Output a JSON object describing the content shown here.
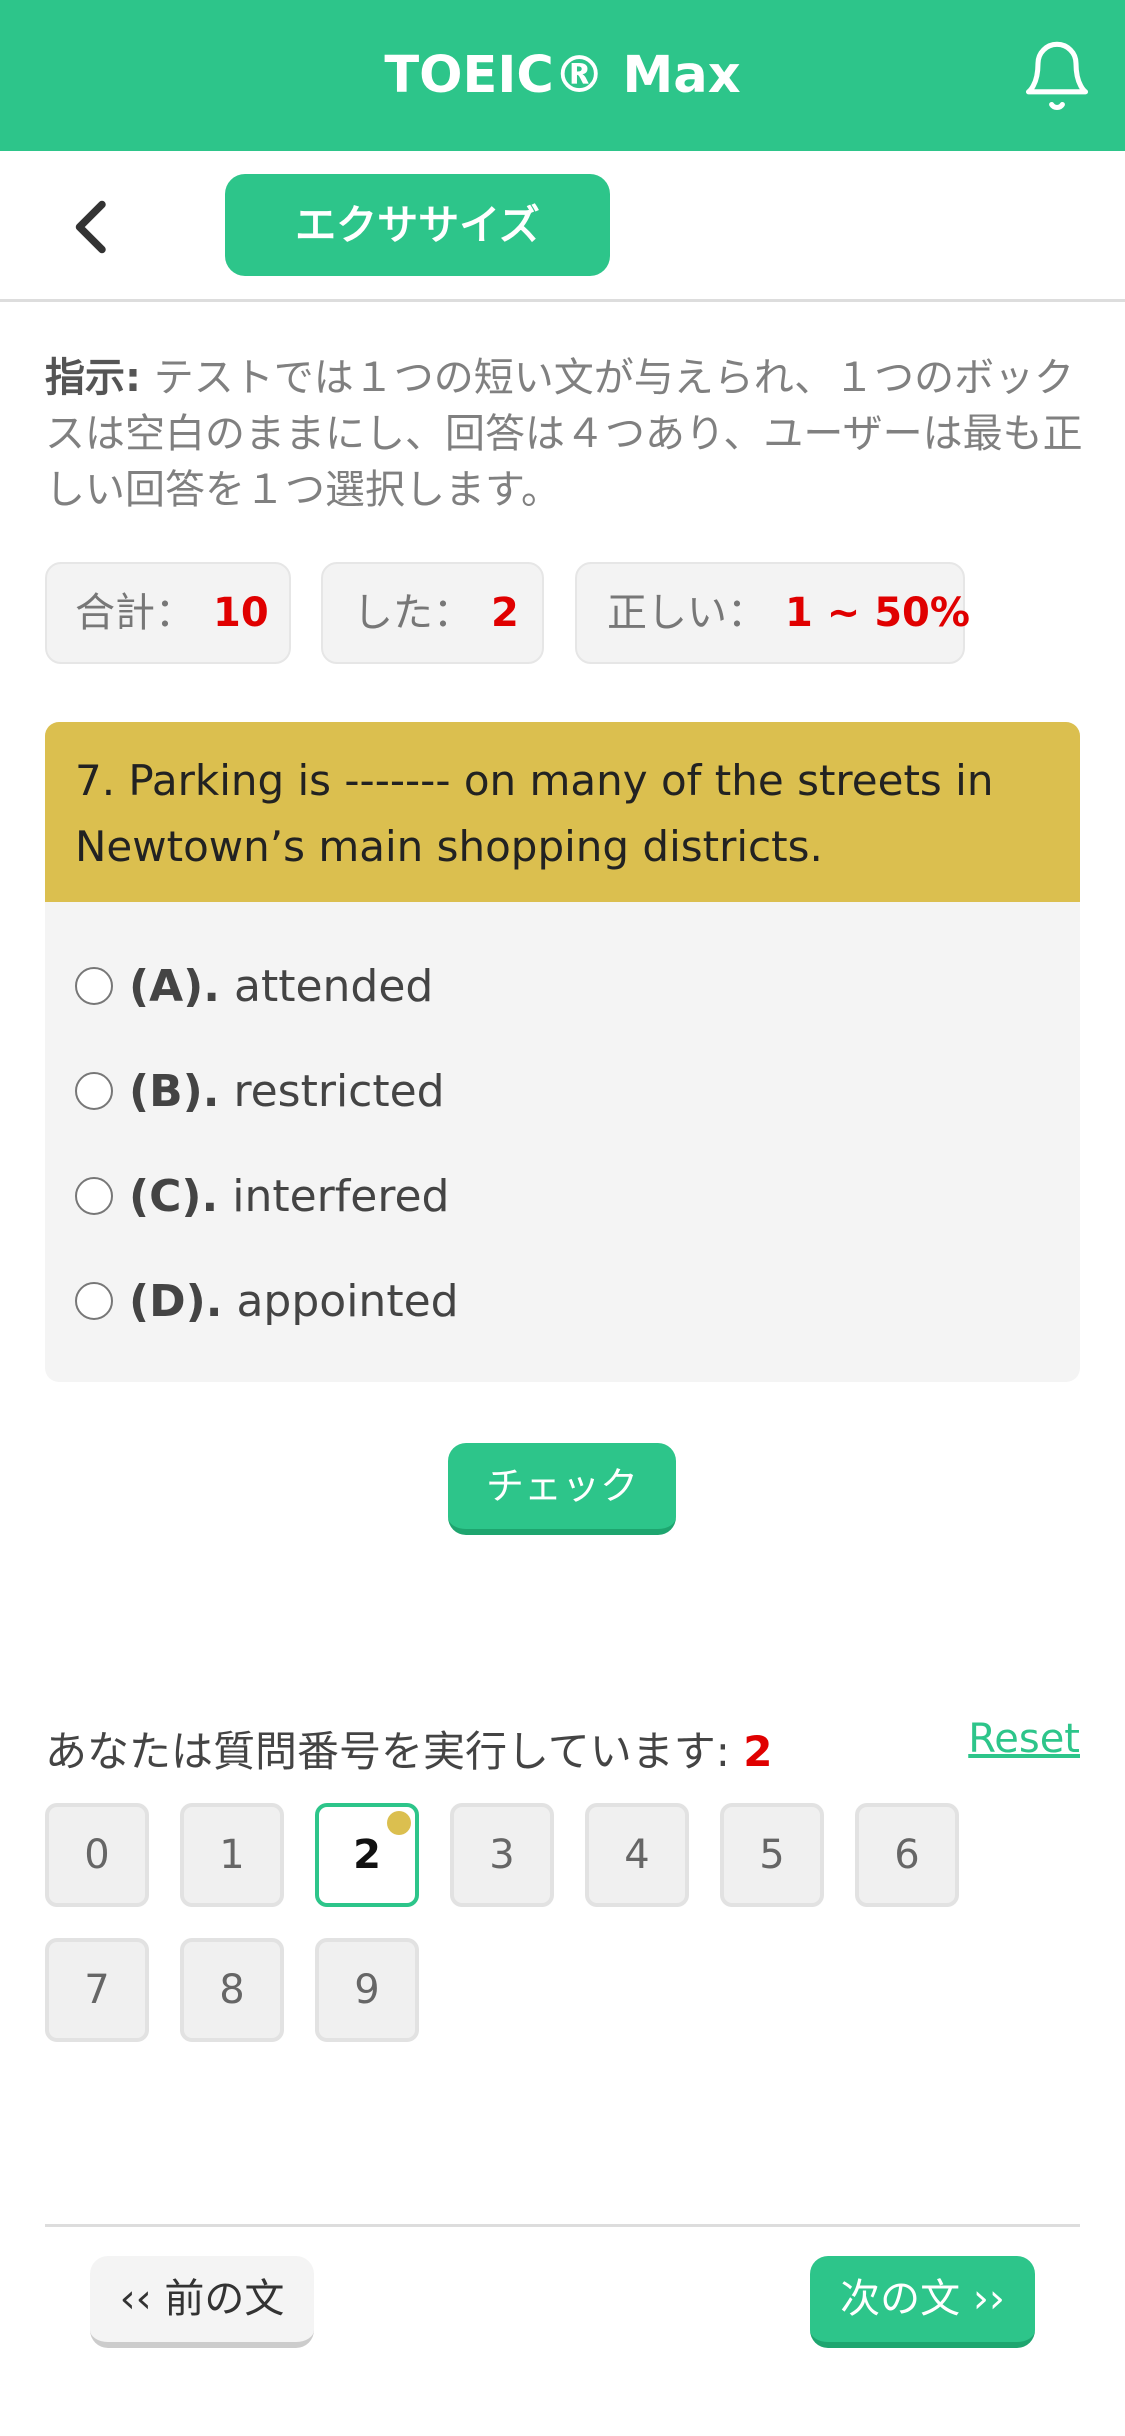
{
  "header": {
    "title": "TOEIC® Max",
    "bell_icon": "bell-icon"
  },
  "subbar": {
    "back_icon": "chevron-left-icon",
    "tab_label": "エクササイズ"
  },
  "instruction": {
    "label": "指示:",
    "text": " テストでは１つの短い文が与えられ、１つのボックスは空白のままにし、回答は４つあり、ユーザーは最も正しい回答を１つ選択します。"
  },
  "stats": [
    {
      "label": "合計：",
      "value": "10"
    },
    {
      "label": "した：",
      "value": "2"
    },
    {
      "label": "正しい：",
      "value": "1 ~ 50%"
    }
  ],
  "question": {
    "text": "7. Parking is ------- on many of the streets in Newtown’s main shopping districts.",
    "options": [
      {
        "label": "(A).",
        "text": "attended"
      },
      {
        "label": "(B).",
        "text": "restricted"
      },
      {
        "label": "(C).",
        "text": "interfered"
      },
      {
        "label": "(D).",
        "text": "appointed"
      }
    ]
  },
  "check_label": "チェック",
  "progress": {
    "running_text": "あなたは質問番号を実行しています:",
    "current": "2",
    "reset_label": "Reset",
    "numbers": [
      "0",
      "1",
      "2",
      "3",
      "4",
      "5",
      "6",
      "7",
      "8",
      "9"
    ]
  },
  "nav": {
    "prev_label": "‹‹ 前の文",
    "next_label": "次の文 ››"
  },
  "colors": {
    "accent": "#2dc58a",
    "question_bg": "#dbbf4f",
    "highlight": "#e00000"
  }
}
